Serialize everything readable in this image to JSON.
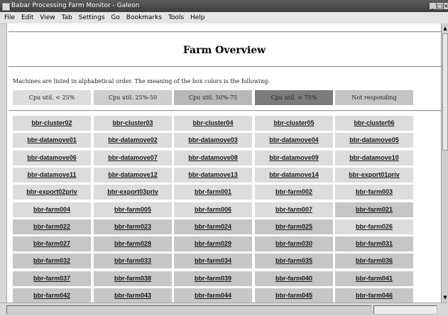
{
  "window": {
    "title": "Babar Processing Farm Monitor - Galeon",
    "controls": [
      "_",
      "□",
      "×"
    ]
  },
  "menu": [
    "File",
    "Edit",
    "View",
    "Tab",
    "Settings",
    "Go",
    "Bookmarks",
    "Tools",
    "Help"
  ],
  "page": {
    "title": "Farm Overview",
    "intro": "Machines are listed in alphabetical order. The meaning of the box colors is the following:"
  },
  "legend": [
    {
      "label": "Cpu util. < 25%",
      "color": "#dcdcdc"
    },
    {
      "label": "Cpu util. 25%-50",
      "color": "#cecece"
    },
    {
      "label": "Cpu util. 50%-75",
      "color": "#b8b8b8"
    },
    {
      "label": "Cpu util. > 75%",
      "color": "#7c7c7c"
    },
    {
      "label": "Not responding",
      "color": "#c4c4c4"
    }
  ],
  "machines": [
    [
      {
        "name": "bbr-cluster02",
        "level": "under25"
      },
      {
        "name": "bbr-cluster03",
        "level": "under25"
      },
      {
        "name": "bbr-cluster04",
        "level": "under25"
      },
      {
        "name": "bbr-cluster05",
        "level": "under25"
      },
      {
        "name": "bbr-cluster06",
        "level": "under25"
      }
    ],
    [
      {
        "name": "bbr-datamove01",
        "level": "under25"
      },
      {
        "name": "bbr-datamove02",
        "level": "under25"
      },
      {
        "name": "bbr-datamove03",
        "level": "under25"
      },
      {
        "name": "bbr-datamove04",
        "level": "under25"
      },
      {
        "name": "bbr-datamove05",
        "level": "under25"
      }
    ],
    [
      {
        "name": "bbr-datamove06",
        "level": "under25"
      },
      {
        "name": "bbr-datamove07",
        "level": "under25"
      },
      {
        "name": "bbr-datamove08",
        "level": "under25"
      },
      {
        "name": "bbr-datamove09",
        "level": "under25"
      },
      {
        "name": "bbr-datamove10",
        "level": "under25"
      }
    ],
    [
      {
        "name": "bbr-datamove11",
        "level": "under25"
      },
      {
        "name": "bbr-datamove12",
        "level": "under25"
      },
      {
        "name": "bbr-datamove13",
        "level": "under25"
      },
      {
        "name": "bbr-datamove14",
        "level": "under25"
      },
      {
        "name": "bbr-export01priv",
        "level": "under25"
      }
    ],
    [
      {
        "name": "bbr-export02priv",
        "level": "under25"
      },
      {
        "name": "bbr-export03priv",
        "level": "under25"
      },
      {
        "name": "bbr-farm001",
        "level": "under25"
      },
      {
        "name": "bbr-farm002",
        "level": "under25"
      },
      {
        "name": "bbr-farm003",
        "level": "under25"
      }
    ],
    [
      {
        "name": "bbr-farm004",
        "level": "under25"
      },
      {
        "name": "bbr-farm005",
        "level": "under25"
      },
      {
        "name": "bbr-farm006",
        "level": "under25"
      },
      {
        "name": "bbr-farm007",
        "level": "under25"
      },
      {
        "name": "bbr-farm021",
        "level": "mid"
      }
    ],
    [
      {
        "name": "bbr-farm022",
        "level": "mid"
      },
      {
        "name": "bbr-farm023",
        "level": "mid"
      },
      {
        "name": "bbr-farm024",
        "level": "mid"
      },
      {
        "name": "bbr-farm025",
        "level": "mid"
      },
      {
        "name": "bbr-farm026",
        "level": "under25"
      }
    ],
    [
      {
        "name": "bbr-farm027",
        "level": "mid"
      },
      {
        "name": "bbr-farm028",
        "level": "mid"
      },
      {
        "name": "bbr-farm029",
        "level": "mid"
      },
      {
        "name": "bbr-farm030",
        "level": "mid"
      },
      {
        "name": "bbr-farm031",
        "level": "mid"
      }
    ],
    [
      {
        "name": "bbr-farm032",
        "level": "mid"
      },
      {
        "name": "bbr-farm033",
        "level": "mid"
      },
      {
        "name": "bbr-farm034",
        "level": "mid"
      },
      {
        "name": "bbr-farm035",
        "level": "mid"
      },
      {
        "name": "bbr-farm036",
        "level": "mid"
      }
    ],
    [
      {
        "name": "bbr-farm037",
        "level": "mid"
      },
      {
        "name": "bbr-farm038",
        "level": "mid"
      },
      {
        "name": "bbr-farm039",
        "level": "mid"
      },
      {
        "name": "bbr-farm040",
        "level": "mid"
      },
      {
        "name": "bbr-farm041",
        "level": "mid"
      }
    ],
    [
      {
        "name": "bbr-farm042",
        "level": "mid"
      },
      {
        "name": "bbr-farm043",
        "level": "mid"
      },
      {
        "name": "bbr-farm044",
        "level": "mid"
      },
      {
        "name": "bbr-farm045",
        "level": "mid"
      },
      {
        "name": "bbr-farm046",
        "level": "mid"
      }
    ]
  ],
  "level_colors": {
    "under25": "#dcdcdc",
    "mid": "#c6c6c6"
  }
}
